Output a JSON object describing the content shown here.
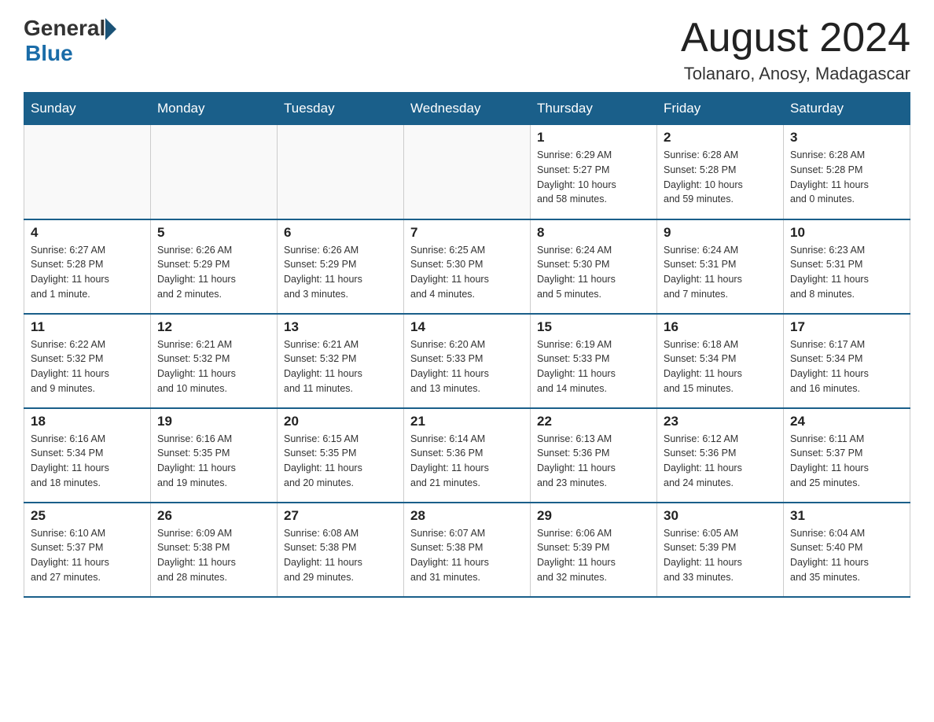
{
  "header": {
    "logo_general": "General",
    "logo_blue": "Blue",
    "month_title": "August 2024",
    "location": "Tolanaro, Anosy, Madagascar"
  },
  "days_of_week": [
    "Sunday",
    "Monday",
    "Tuesday",
    "Wednesday",
    "Thursday",
    "Friday",
    "Saturday"
  ],
  "weeks": [
    [
      {
        "day": "",
        "info": ""
      },
      {
        "day": "",
        "info": ""
      },
      {
        "day": "",
        "info": ""
      },
      {
        "day": "",
        "info": ""
      },
      {
        "day": "1",
        "info": "Sunrise: 6:29 AM\nSunset: 5:27 PM\nDaylight: 10 hours\nand 58 minutes."
      },
      {
        "day": "2",
        "info": "Sunrise: 6:28 AM\nSunset: 5:28 PM\nDaylight: 10 hours\nand 59 minutes."
      },
      {
        "day": "3",
        "info": "Sunrise: 6:28 AM\nSunset: 5:28 PM\nDaylight: 11 hours\nand 0 minutes."
      }
    ],
    [
      {
        "day": "4",
        "info": "Sunrise: 6:27 AM\nSunset: 5:28 PM\nDaylight: 11 hours\nand 1 minute."
      },
      {
        "day": "5",
        "info": "Sunrise: 6:26 AM\nSunset: 5:29 PM\nDaylight: 11 hours\nand 2 minutes."
      },
      {
        "day": "6",
        "info": "Sunrise: 6:26 AM\nSunset: 5:29 PM\nDaylight: 11 hours\nand 3 minutes."
      },
      {
        "day": "7",
        "info": "Sunrise: 6:25 AM\nSunset: 5:30 PM\nDaylight: 11 hours\nand 4 minutes."
      },
      {
        "day": "8",
        "info": "Sunrise: 6:24 AM\nSunset: 5:30 PM\nDaylight: 11 hours\nand 5 minutes."
      },
      {
        "day": "9",
        "info": "Sunrise: 6:24 AM\nSunset: 5:31 PM\nDaylight: 11 hours\nand 7 minutes."
      },
      {
        "day": "10",
        "info": "Sunrise: 6:23 AM\nSunset: 5:31 PM\nDaylight: 11 hours\nand 8 minutes."
      }
    ],
    [
      {
        "day": "11",
        "info": "Sunrise: 6:22 AM\nSunset: 5:32 PM\nDaylight: 11 hours\nand 9 minutes."
      },
      {
        "day": "12",
        "info": "Sunrise: 6:21 AM\nSunset: 5:32 PM\nDaylight: 11 hours\nand 10 minutes."
      },
      {
        "day": "13",
        "info": "Sunrise: 6:21 AM\nSunset: 5:32 PM\nDaylight: 11 hours\nand 11 minutes."
      },
      {
        "day": "14",
        "info": "Sunrise: 6:20 AM\nSunset: 5:33 PM\nDaylight: 11 hours\nand 13 minutes."
      },
      {
        "day": "15",
        "info": "Sunrise: 6:19 AM\nSunset: 5:33 PM\nDaylight: 11 hours\nand 14 minutes."
      },
      {
        "day": "16",
        "info": "Sunrise: 6:18 AM\nSunset: 5:34 PM\nDaylight: 11 hours\nand 15 minutes."
      },
      {
        "day": "17",
        "info": "Sunrise: 6:17 AM\nSunset: 5:34 PM\nDaylight: 11 hours\nand 16 minutes."
      }
    ],
    [
      {
        "day": "18",
        "info": "Sunrise: 6:16 AM\nSunset: 5:34 PM\nDaylight: 11 hours\nand 18 minutes."
      },
      {
        "day": "19",
        "info": "Sunrise: 6:16 AM\nSunset: 5:35 PM\nDaylight: 11 hours\nand 19 minutes."
      },
      {
        "day": "20",
        "info": "Sunrise: 6:15 AM\nSunset: 5:35 PM\nDaylight: 11 hours\nand 20 minutes."
      },
      {
        "day": "21",
        "info": "Sunrise: 6:14 AM\nSunset: 5:36 PM\nDaylight: 11 hours\nand 21 minutes."
      },
      {
        "day": "22",
        "info": "Sunrise: 6:13 AM\nSunset: 5:36 PM\nDaylight: 11 hours\nand 23 minutes."
      },
      {
        "day": "23",
        "info": "Sunrise: 6:12 AM\nSunset: 5:36 PM\nDaylight: 11 hours\nand 24 minutes."
      },
      {
        "day": "24",
        "info": "Sunrise: 6:11 AM\nSunset: 5:37 PM\nDaylight: 11 hours\nand 25 minutes."
      }
    ],
    [
      {
        "day": "25",
        "info": "Sunrise: 6:10 AM\nSunset: 5:37 PM\nDaylight: 11 hours\nand 27 minutes."
      },
      {
        "day": "26",
        "info": "Sunrise: 6:09 AM\nSunset: 5:38 PM\nDaylight: 11 hours\nand 28 minutes."
      },
      {
        "day": "27",
        "info": "Sunrise: 6:08 AM\nSunset: 5:38 PM\nDaylight: 11 hours\nand 29 minutes."
      },
      {
        "day": "28",
        "info": "Sunrise: 6:07 AM\nSunset: 5:38 PM\nDaylight: 11 hours\nand 31 minutes."
      },
      {
        "day": "29",
        "info": "Sunrise: 6:06 AM\nSunset: 5:39 PM\nDaylight: 11 hours\nand 32 minutes."
      },
      {
        "day": "30",
        "info": "Sunrise: 6:05 AM\nSunset: 5:39 PM\nDaylight: 11 hours\nand 33 minutes."
      },
      {
        "day": "31",
        "info": "Sunrise: 6:04 AM\nSunset: 5:40 PM\nDaylight: 11 hours\nand 35 minutes."
      }
    ]
  ]
}
